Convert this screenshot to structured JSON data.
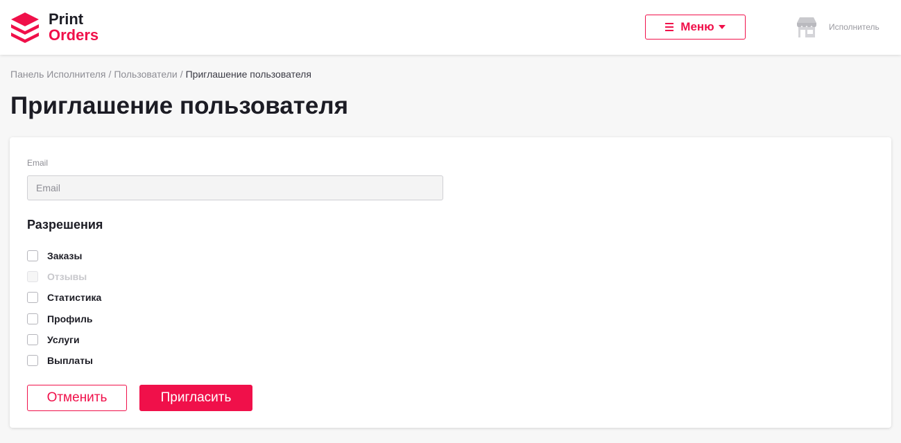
{
  "brand": {
    "line1": "Print",
    "line2": "Orders",
    "accent_color": "#f0104a",
    "logo_icon": "stacked-layers-icon"
  },
  "header": {
    "menu_label": "Меню",
    "menu_icon": "hamburger-icon",
    "user_icon": "storefront-icon",
    "user_role": "Исполнитель"
  },
  "breadcrumb": {
    "items": [
      "Панель Исполнителя",
      "Пользователи",
      "Приглашение пользователя"
    ],
    "separator": "/"
  },
  "page": {
    "title": "Приглашение пользователя"
  },
  "form": {
    "email_label": "Email",
    "email_placeholder": "Email",
    "email_value": "",
    "permissions_title": "Разрешения",
    "permissions": [
      {
        "label": "Заказы",
        "checked": false,
        "disabled": false
      },
      {
        "label": "Отзывы",
        "checked": false,
        "disabled": true
      },
      {
        "label": "Статистика",
        "checked": false,
        "disabled": false
      },
      {
        "label": "Профиль",
        "checked": false,
        "disabled": false
      },
      {
        "label": "Услуги",
        "checked": false,
        "disabled": false
      },
      {
        "label": "Выплаты",
        "checked": false,
        "disabled": false
      }
    ],
    "cancel_label": "Отменить",
    "invite_label": "Пригласить"
  }
}
